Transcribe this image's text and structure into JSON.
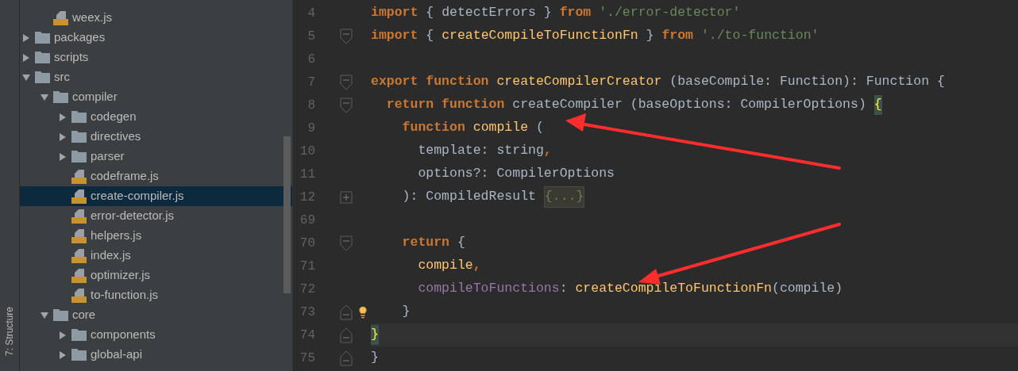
{
  "tool_strip": {
    "label": "7: Structure"
  },
  "tree": {
    "continued": [
      {
        "label": "weex.js",
        "kind": "file",
        "selected": false
      }
    ],
    "items": [
      {
        "label": "packages",
        "kind": "folder",
        "expanded": false,
        "selected": false
      },
      {
        "label": "scripts",
        "kind": "folder",
        "expanded": false,
        "selected": false
      },
      {
        "label": "src",
        "kind": "folder",
        "expanded": true,
        "selected": false,
        "children": [
          {
            "label": "compiler",
            "kind": "folder",
            "expanded": true,
            "selected": false,
            "children": [
              {
                "label": "codegen",
                "kind": "folder",
                "expanded": false,
                "selected": false
              },
              {
                "label": "directives",
                "kind": "folder",
                "expanded": false,
                "selected": false
              },
              {
                "label": "parser",
                "kind": "folder",
                "expanded": false,
                "selected": false
              },
              {
                "label": "codeframe.js",
                "kind": "file",
                "selected": false
              },
              {
                "label": "create-compiler.js",
                "kind": "file",
                "selected": true
              },
              {
                "label": "error-detector.js",
                "kind": "file",
                "selected": false
              },
              {
                "label": "helpers.js",
                "kind": "file",
                "selected": false
              },
              {
                "label": "index.js",
                "kind": "file",
                "selected": false
              },
              {
                "label": "optimizer.js",
                "kind": "file",
                "selected": false
              },
              {
                "label": "to-function.js",
                "kind": "file",
                "selected": false
              }
            ]
          },
          {
            "label": "core",
            "kind": "folder",
            "expanded": true,
            "selected": false,
            "children": [
              {
                "label": "components",
                "kind": "folder",
                "expanded": false,
                "selected": false
              },
              {
                "label": "global-api",
                "kind": "folder",
                "expanded": false,
                "selected": false
              }
            ]
          }
        ]
      }
    ]
  },
  "editor": {
    "lines": [
      {
        "number": "4",
        "tokens": [
          {
            "kind": "keyword",
            "s": "import"
          },
          {
            "kind": "plain",
            "s": " { detectErrors } "
          },
          {
            "kind": "keyword",
            "s": "from"
          },
          {
            "kind": "string",
            "s": " './error-detector'"
          }
        ]
      },
      {
        "number": "5",
        "marker": {
          "kind": "fold_start"
        },
        "tokens": [
          {
            "kind": "keyword",
            "s": "import"
          },
          {
            "kind": "plain",
            "s": " { "
          },
          {
            "kind": "ident",
            "s": "createCompileToFunctionFn"
          },
          {
            "kind": "plain",
            "s": " } "
          },
          {
            "kind": "keyword",
            "s": "from"
          },
          {
            "kind": "string",
            "s": " './to-function'"
          }
        ]
      },
      {
        "number": "6"
      },
      {
        "number": "7",
        "marker": {
          "kind": "fold_start"
        },
        "tokens": [
          {
            "kind": "keyword",
            "s": "export function "
          },
          {
            "kind": "ident",
            "s": "createCompilerCreator"
          },
          {
            "kind": "plain",
            "s": " (baseCompile: Function): Function {"
          }
        ]
      },
      {
        "number": "8",
        "marker": {
          "kind": "fold_start"
        },
        "tokens": [
          {
            "kind": "keyword",
            "s": "  return function "
          },
          {
            "kind": "plain",
            "s": "createCompiler (baseOptions: CompilerOptions) "
          },
          {
            "kind": "brace_match",
            "s": "{"
          }
        ]
      },
      {
        "number": "9",
        "tokens": [
          {
            "kind": "keyword",
            "s": "    function "
          },
          {
            "kind": "ident",
            "s": "compile"
          },
          {
            "kind": "plain",
            "s": " ("
          }
        ]
      },
      {
        "number": "10",
        "tokens": [
          {
            "kind": "plain",
            "s": "      template: string"
          },
          {
            "kind": "keyword",
            "s": ","
          }
        ]
      },
      {
        "number": "11",
        "tokens": [
          {
            "kind": "plain",
            "s": "      options?: CompilerOptions"
          }
        ]
      },
      {
        "number": "12",
        "marker": {
          "kind": "collapsed"
        },
        "tokens": [
          {
            "kind": "plain",
            "s": "    ): CompiledResult "
          },
          {
            "kind": "folded",
            "s": "{...}"
          }
        ]
      },
      {
        "number": "69"
      },
      {
        "number": "70",
        "marker": {
          "kind": "fold_start"
        },
        "tokens": [
          {
            "kind": "keyword",
            "s": "    return"
          },
          {
            "kind": "plain",
            "s": " {"
          }
        ]
      },
      {
        "number": "71",
        "tokens": [
          {
            "kind": "ident",
            "s": "      compile"
          },
          {
            "kind": "keyword",
            "s": ","
          }
        ]
      },
      {
        "number": "72",
        "tokens": [
          {
            "kind": "prop",
            "s": "      compileToFunctions"
          },
          {
            "kind": "plain",
            "s": ": "
          },
          {
            "kind": "ident",
            "s": "createCompileToFunctionFn"
          },
          {
            "kind": "plain",
            "s": "(compile)"
          }
        ]
      },
      {
        "number": "73",
        "bulb": true,
        "marker": {
          "kind": "fold_end"
        },
        "tokens": [
          {
            "kind": "plain",
            "s": "    }"
          }
        ]
      },
      {
        "number": "74",
        "current": true,
        "marker": {
          "kind": "fold_end"
        },
        "tokens": [
          {
            "kind": "brace_match",
            "s": "}"
          }
        ]
      },
      {
        "number": "75",
        "marker": {
          "kind": "fold_end"
        },
        "tokens": [
          {
            "kind": "plain",
            "s": "}"
          }
        ]
      }
    ]
  }
}
